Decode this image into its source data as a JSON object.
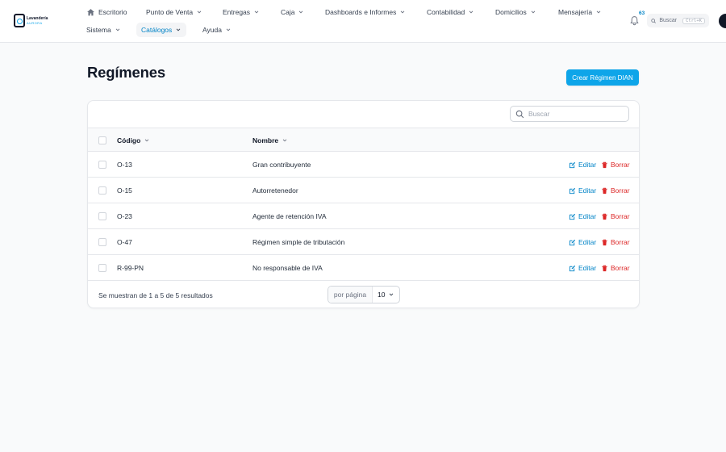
{
  "brand": {
    "line1": "Lavandería",
    "line2": "AURORA"
  },
  "nav": {
    "row1": [
      {
        "label": "Escritorio",
        "icon": "home-icon"
      },
      {
        "label": "Punto de Venta"
      },
      {
        "label": "Entregas"
      },
      {
        "label": "Caja"
      },
      {
        "label": "Dashboards e Informes"
      },
      {
        "label": "Contabilidad"
      },
      {
        "label": "Domicilios"
      },
      {
        "label": "Mensajería"
      }
    ],
    "row2": [
      {
        "label": "Sistema"
      },
      {
        "label": "Catálogos",
        "active": true
      },
      {
        "label": "Ayuda"
      }
    ]
  },
  "notifications": {
    "count": "63"
  },
  "global_search": {
    "label": "Buscar",
    "shortcut": "Ctrl+K"
  },
  "page": {
    "title": "Regímenes",
    "create_label": "Crear Régimen DIAN"
  },
  "table": {
    "search_placeholder": "Buscar",
    "columns": {
      "codigo": "Código",
      "nombre": "Nombre"
    },
    "rows": [
      {
        "codigo": "O-13",
        "nombre": "Gran contribuyente"
      },
      {
        "codigo": "O-15",
        "nombre": "Autorretenedor"
      },
      {
        "codigo": "O-23",
        "nombre": "Agente de retención IVA"
      },
      {
        "codigo": "O-47",
        "nombre": "Régimen simple de tributación"
      },
      {
        "codigo": "R-99-PN",
        "nombre": "No responsable de IVA"
      }
    ],
    "actions": {
      "edit": "Editar",
      "delete": "Borrar"
    },
    "footer": {
      "summary": "Se muestran de 1 a 5 de 5 resultados",
      "per_page_label": "por página",
      "per_page_value": "10"
    }
  },
  "colors": {
    "accent": "#0ea5e9",
    "link": "#0284c7",
    "danger": "#dc2626"
  }
}
